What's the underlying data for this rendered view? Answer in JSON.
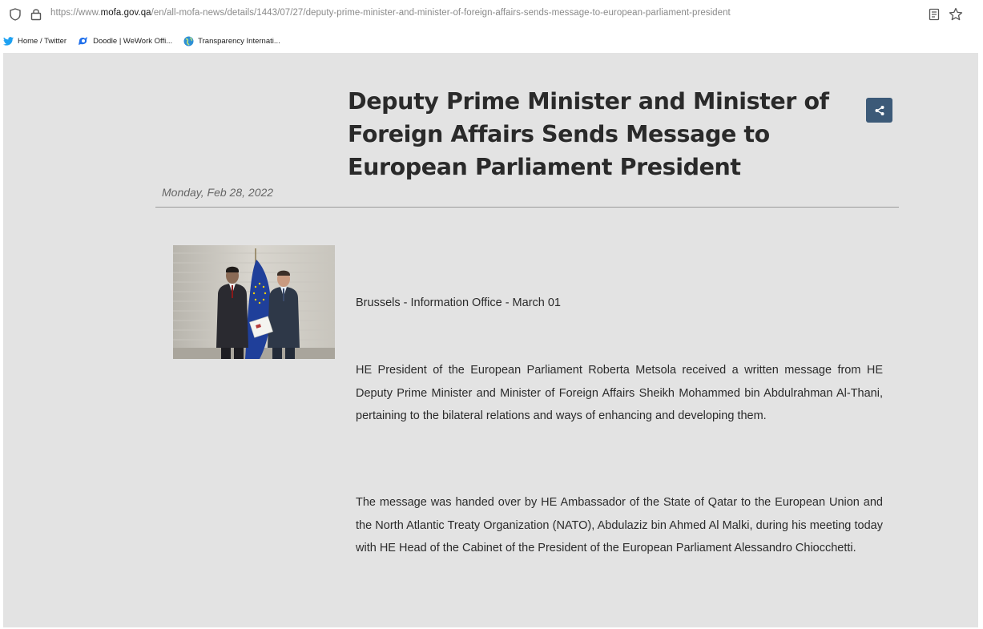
{
  "browser": {
    "url_prefix": "https://www.",
    "url_host": "mofa.gov.qa",
    "url_path": "/en/all-mofa-news/details/1443/07/27/deputy-prime-minister-and-minister-of-foreign-affairs-sends-message-to-european-parliament-president",
    "bookmarks": [
      {
        "label": "Home / Twitter",
        "icon": "twitter-icon"
      },
      {
        "label": "Doodle | WeWork Offi...",
        "icon": "doodle-icon"
      },
      {
        "label": "Transparency Internati...",
        "icon": "globe-icon"
      }
    ]
  },
  "article": {
    "title": "Deputy Prime Minister and Minister of Foreign Affairs Sends Message to European Parliament President",
    "date": "Monday, Feb 28, 2022",
    "dateline": "Brussels - Information Office - March 01",
    "paragraph_1": "HE President of the European Parliament Roberta Metsola received a written message from HE Deputy Prime Minister and Minister of Foreign Affairs Sheikh Mohammed bin Abdulrahman Al-Thani, pertaining to the bilateral relations and ways of enhancing and developing them.",
    "paragraph_2": "The message was handed over by HE Ambassador of the State of Qatar to the European Union and the North Atlantic Treaty Organization (NATO), Abdulaziz bin Ahmed Al Malki, during his meeting today with HE Head of the Cabinet of the President of the European Parliament Alessandro Chiocchetti."
  },
  "colors": {
    "page_background": "#e3e3e3",
    "share_button": "#3c5a78",
    "eu_flag": "#1f3f9a"
  }
}
